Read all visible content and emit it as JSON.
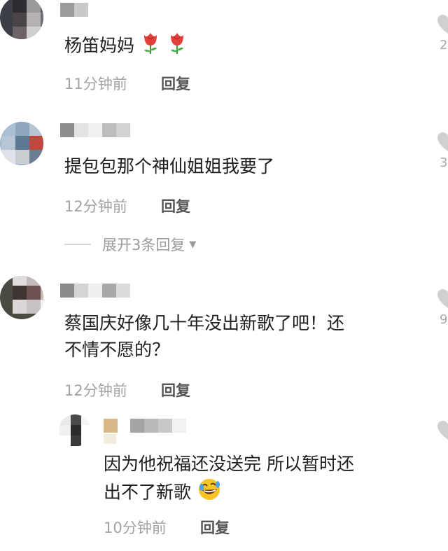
{
  "comments": [
    {
      "text": "杨笛妈妈",
      "emoji": [
        "tulip-icon",
        "tulip-icon"
      ],
      "time": "11分钟前",
      "reply_label": "回复",
      "likes": "2"
    },
    {
      "text": "提包包那个神仙姐姐我要了",
      "time": "12分钟前",
      "reply_label": "回复",
      "likes": "3",
      "expand_label": "展开3条回复"
    },
    {
      "text_line1": "蔡国庆好像几十年没出新歌了吧！还",
      "text_line2": "不情不愿的？",
      "time": "12分钟前",
      "reply_label": "回复",
      "likes": "9"
    }
  ],
  "sub_reply": {
    "text_line1": "因为他祝福还没送完 所以暂时还",
    "text_line2": "出不了新歌",
    "emoji": "rolling-laughing-icon",
    "time": "10分钟前",
    "reply_label": "回复"
  },
  "colors": {
    "comment_text": "#1d1d1d",
    "meta_text": "#a3a3a3",
    "reply_text": "#555555",
    "like_icon": "#c8c8c8"
  }
}
